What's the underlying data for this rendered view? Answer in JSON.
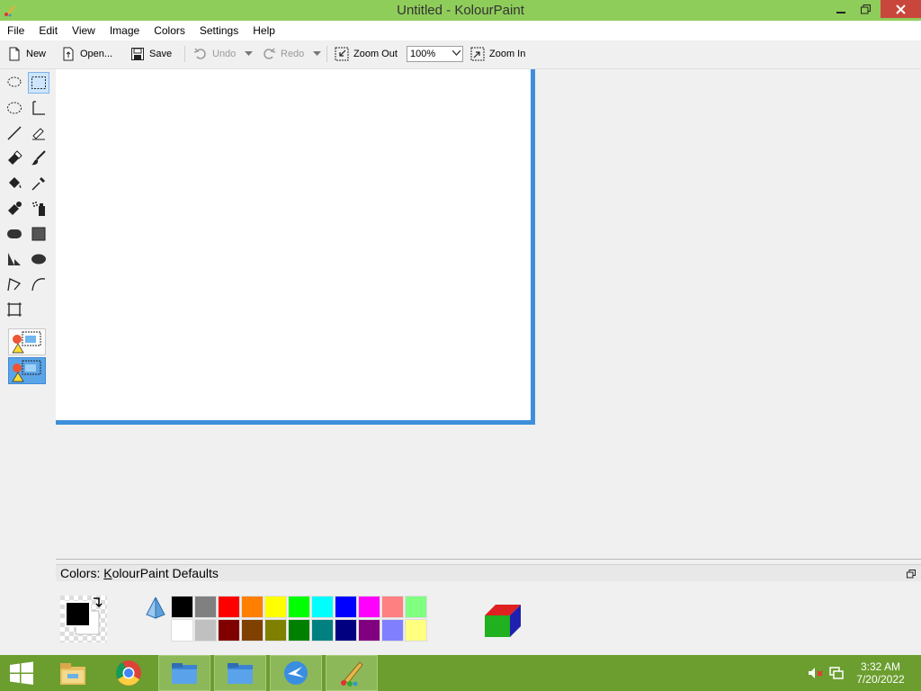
{
  "window": {
    "title": "Untitled  - KolourPaint"
  },
  "menu": [
    "File",
    "Edit",
    "View",
    "Image",
    "Colors",
    "Settings",
    "Help"
  ],
  "toolbar": {
    "new_label": "New",
    "open_label": "Open...",
    "save_label": "Save",
    "undo_label": "Undo",
    "redo_label": "Redo",
    "zoom_out_label": "Zoom Out",
    "zoom_value": "100%",
    "zoom_in_label": "Zoom In"
  },
  "tools": [
    {
      "name": "free-form-selection",
      "icon": "lasso-icon"
    },
    {
      "name": "rectangular-selection",
      "icon": "rect-select-icon",
      "active": true
    },
    {
      "name": "elliptical-selection",
      "icon": "ellipse-select-icon"
    },
    {
      "name": "text",
      "icon": "text-icon"
    },
    {
      "name": "line",
      "icon": "line-icon"
    },
    {
      "name": "pen",
      "icon": "pen-icon"
    },
    {
      "name": "eraser",
      "icon": "eraser-icon"
    },
    {
      "name": "brush",
      "icon": "brush-icon"
    },
    {
      "name": "flood-fill",
      "icon": "bucket-icon"
    },
    {
      "name": "color-picker",
      "icon": "eyedropper-icon"
    },
    {
      "name": "color-eraser",
      "icon": "color-eraser-icon"
    },
    {
      "name": "spraycan",
      "icon": "spraycan-icon"
    },
    {
      "name": "rounded-rectangle",
      "icon": "rounded-rect-icon"
    },
    {
      "name": "rectangle",
      "icon": "rectangle-icon"
    },
    {
      "name": "polygon",
      "icon": "polygon-icon"
    },
    {
      "name": "ellipse",
      "icon": "ellipse-icon"
    },
    {
      "name": "connected-lines",
      "icon": "polyline-icon"
    },
    {
      "name": "curve",
      "icon": "curve-icon"
    },
    {
      "name": "zoom",
      "icon": "crop-icon"
    }
  ],
  "colors": {
    "header_prefix": "Colors: ",
    "header_u": "K",
    "header_rest": "olourPaint Defaults",
    "foreground": "#000000",
    "background": "#ffffff",
    "palette_row1": [
      "#000000",
      "#808080",
      "#ff0000",
      "#ff8000",
      "#ffff00",
      "#00ff00",
      "#00ffff",
      "#0000ff",
      "#ff00ff",
      "#ff8080",
      "#80ff80"
    ],
    "palette_row2": [
      "#ffffff",
      "#c0c0c0",
      "#800000",
      "#804000",
      "#808000",
      "#008000",
      "#008080",
      "#000080",
      "#800080",
      "#8080ff",
      "#ffff80"
    ]
  },
  "accent": {
    "titlebar": "#8fcd5a",
    "canvas_border": "#3d8fdc",
    "taskbar": "#6b9e2f",
    "close": "#c9463d"
  },
  "taskbar": {
    "apps": [
      "start-icon",
      "file-explorer-icon",
      "chrome-icon",
      "folder-icon",
      "folder-icon",
      "browser-icon",
      "kolourpaint-icon"
    ],
    "time": "3:32 AM",
    "date": "7/20/2022"
  }
}
